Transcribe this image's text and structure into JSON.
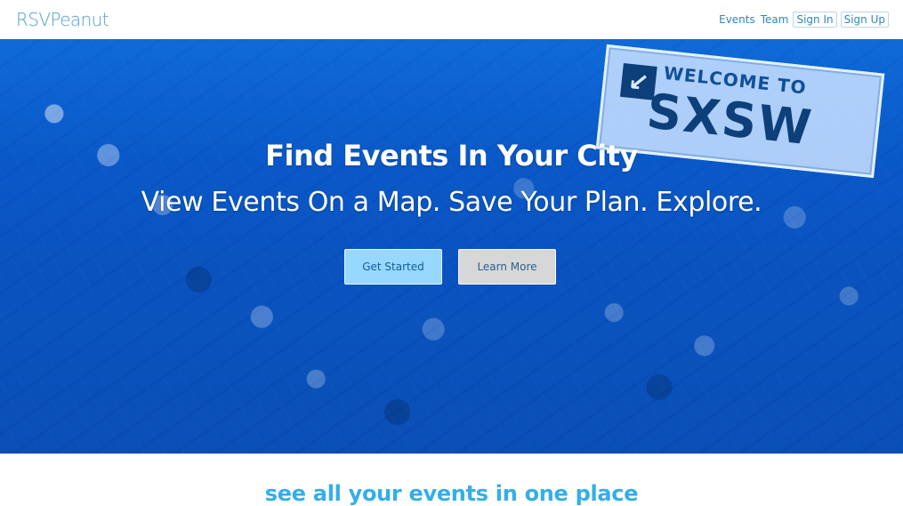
{
  "header": {
    "logo": "RSVPeanut",
    "nav": {
      "events": "Events",
      "team": "Team",
      "sign_in": "Sign In",
      "sign_up": "Sign Up"
    }
  },
  "hero": {
    "title": "Find Events In Your City",
    "subtitle": "View Events On a Map. Save Your Plan. Explore.",
    "buttons": {
      "get_started": "Get Started",
      "learn_more": "Learn More"
    },
    "banner": {
      "welcome": "WELCOME TO",
      "brand": "SXSW"
    }
  },
  "section": {
    "title": "see all your events in one place"
  },
  "colors": {
    "brand_blue": "#33aeea",
    "nav_blue": "#2f87b9",
    "hero_blue": "#0a58c8",
    "primary_button": "#96d8ff",
    "secondary_button": "#d7d7d7"
  }
}
